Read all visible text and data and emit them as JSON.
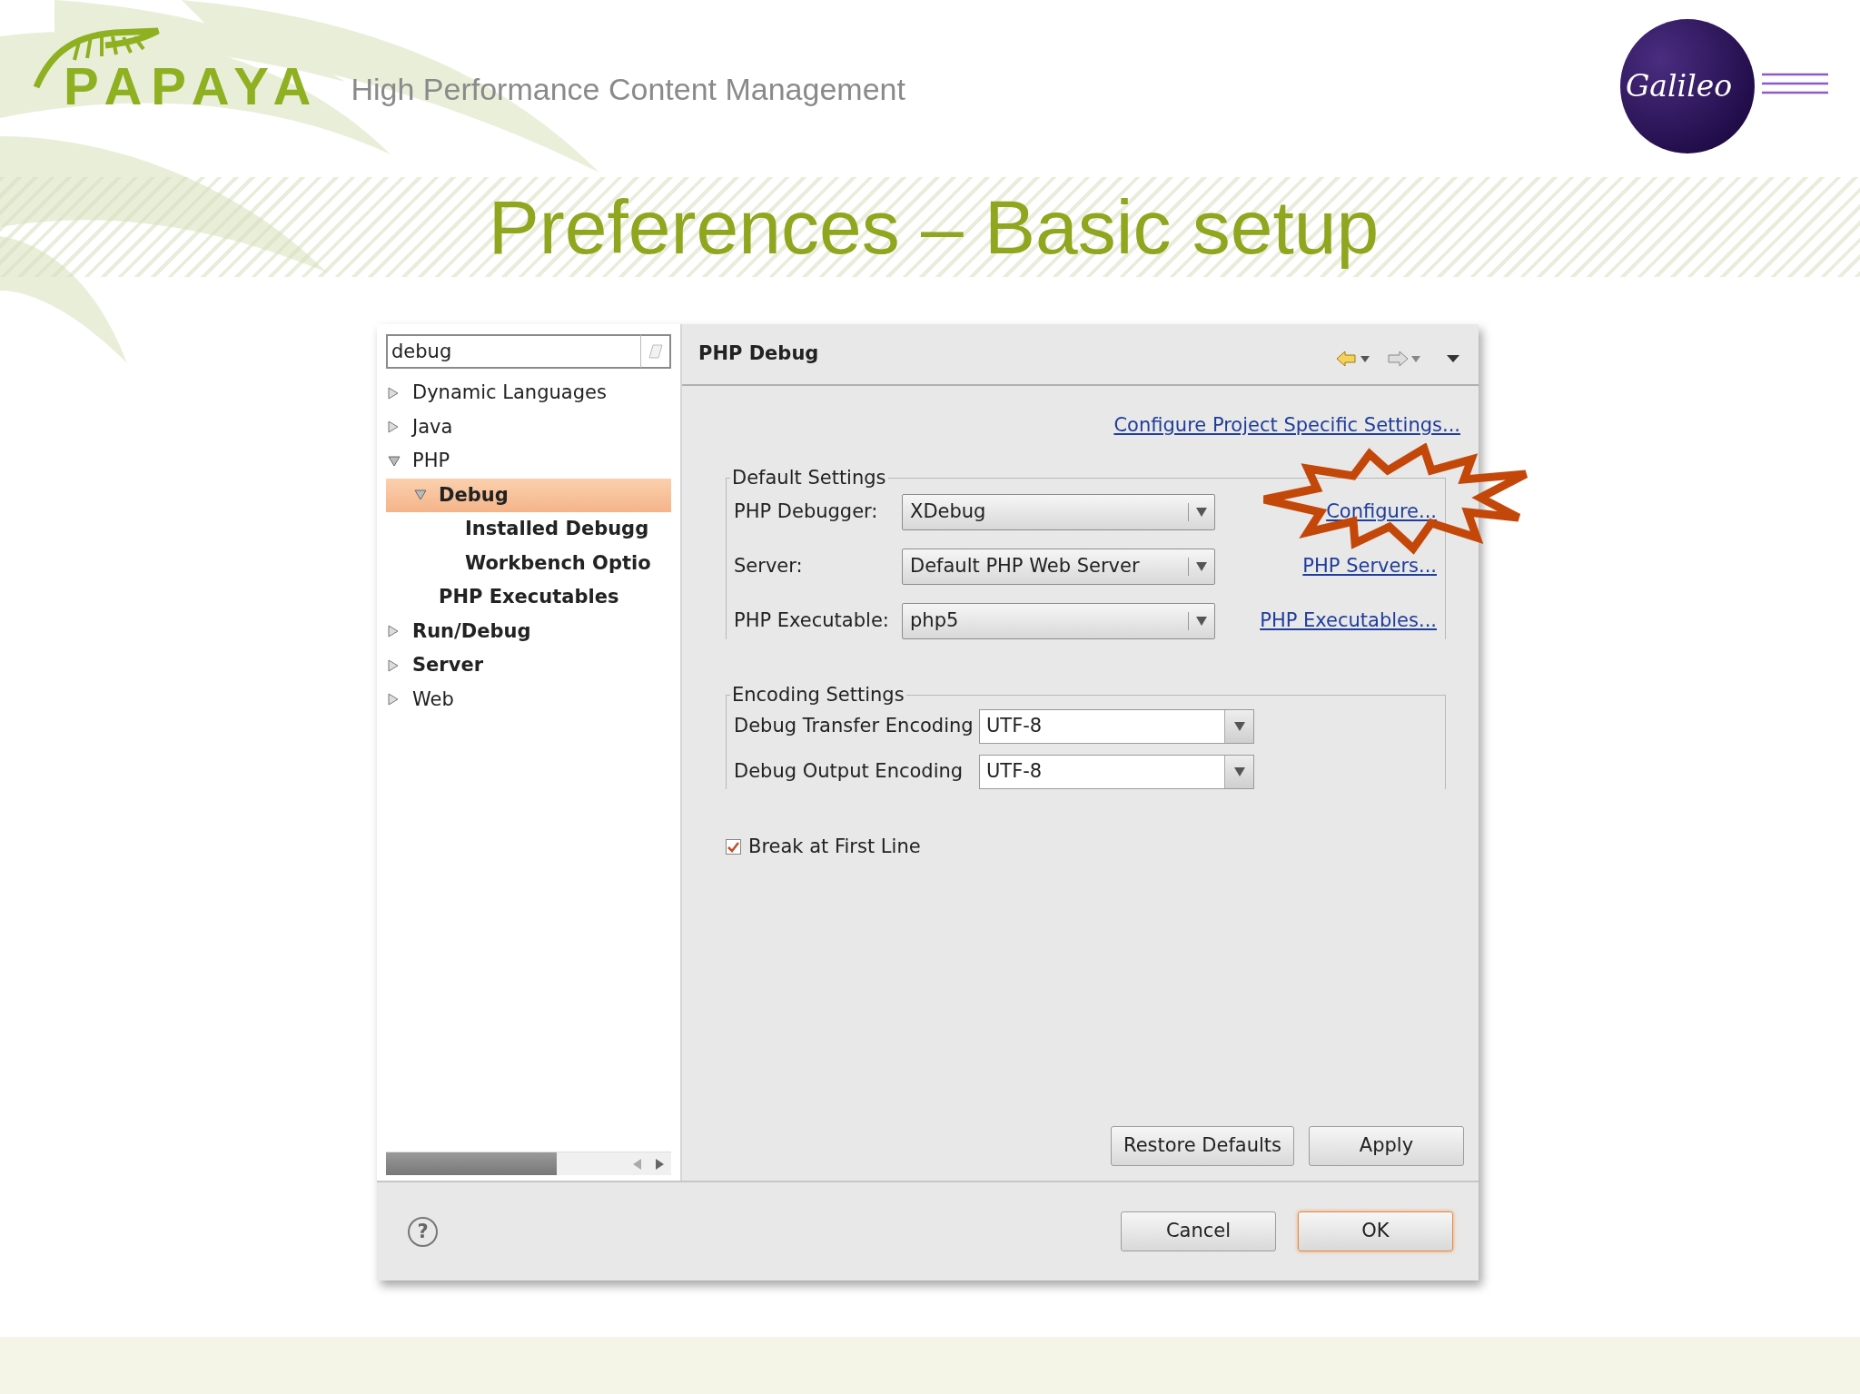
{
  "slide": {
    "brand": "PAPAYA",
    "tagline": "High Performance Content Management",
    "partner_logo": "Galileo",
    "title": "Preferences – Basic setup"
  },
  "dialog": {
    "filter": {
      "value": "debug"
    },
    "tree": [
      {
        "label": "Dynamic Languages",
        "expanded": false,
        "bold": false,
        "selected": false
      },
      {
        "label": "Java",
        "expanded": false,
        "bold": false,
        "selected": false
      },
      {
        "label": "PHP",
        "expanded": true,
        "bold": false,
        "selected": false,
        "children": [
          {
            "label": "Debug",
            "expanded": true,
            "bold": true,
            "selected": true,
            "children": [
              {
                "label": "Installed Debugg",
                "bold": true,
                "selected": false
              },
              {
                "label": "Workbench Optio",
                "bold": true,
                "selected": false
              }
            ]
          },
          {
            "label": "PHP Executables",
            "bold": true,
            "selected": false
          }
        ]
      },
      {
        "label": "Run/Debug",
        "expanded": false,
        "bold": true,
        "selected": false
      },
      {
        "label": "Server",
        "expanded": false,
        "bold": true,
        "selected": false
      },
      {
        "label": "Web",
        "expanded": false,
        "bold": false,
        "selected": false
      }
    ],
    "page_title": "PHP Debug",
    "project_link": "Configure Project Specific Settings...",
    "default_settings": {
      "legend": "Default Settings",
      "rows": [
        {
          "label": "PHP Debugger:",
          "value": "XDebug",
          "link": "Configure..."
        },
        {
          "label": "Server:",
          "value": "Default PHP Web Server",
          "link": "PHP Servers..."
        },
        {
          "label": "PHP Executable:",
          "value": "php5",
          "link": "PHP Executables..."
        }
      ]
    },
    "encoding_settings": {
      "legend": "Encoding Settings",
      "rows": [
        {
          "label": "Debug Transfer Encoding",
          "value": "UTF-8"
        },
        {
          "label": "Debug Output Encoding",
          "value": "UTF-8"
        }
      ]
    },
    "break_at_first_line": {
      "label": "Break at First Line",
      "checked": true
    },
    "page_buttons": [
      {
        "label": "Restore Defaults"
      },
      {
        "label": "Apply"
      }
    ],
    "help": "?",
    "buttons": [
      {
        "label": "Cancel",
        "default": false
      },
      {
        "label": "OK",
        "default": true
      }
    ]
  }
}
